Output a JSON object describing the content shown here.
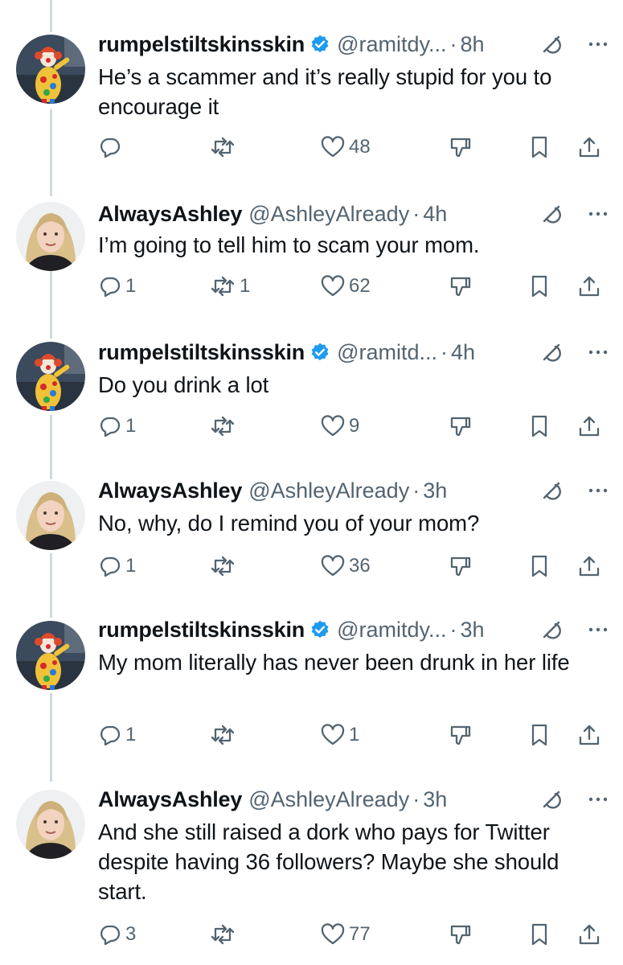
{
  "tweets": [
    {
      "avatar": "clown-avatar",
      "name": "rumpelstiltskinsskin",
      "verified": true,
      "handle": "@ramitdy...",
      "time": "8h",
      "text": "He’s a scammer and it’s really stupid for you to encourage it",
      "replies": "",
      "retweets": "",
      "likes": "48"
    },
    {
      "avatar": "woman-avatar",
      "name": "AlwaysAshley",
      "verified": false,
      "handle": "@AshleyAlready",
      "time": "4h",
      "text": "I’m going to tell him to scam your mom.",
      "replies": "1",
      "retweets": "1",
      "likes": "62"
    },
    {
      "avatar": "clown-avatar",
      "name": "rumpelstiltskinsskin",
      "verified": true,
      "handle": "@ramitd...",
      "time": "4h",
      "text": "Do you drink a lot",
      "replies": "1",
      "retweets": "",
      "likes": "9"
    },
    {
      "avatar": "woman-avatar",
      "name": "AlwaysAshley",
      "verified": false,
      "handle": "@AshleyAlready",
      "time": "3h",
      "text": "No, why, do I remind you of your mom?",
      "replies": "1",
      "retweets": "",
      "likes": "36"
    },
    {
      "avatar": "clown-avatar",
      "name": "rumpelstiltskinsskin",
      "verified": true,
      "handle": "@ramitdy...",
      "time": "3h",
      "text": "My mom literally has never been drunk in her life",
      "replies": "1",
      "retweets": "",
      "likes": "1"
    },
    {
      "avatar": "woman-avatar",
      "name": "AlwaysAshley",
      "verified": false,
      "handle": "@AshleyAlready",
      "time": "3h",
      "text": "And she still raised a dork who pays for Twitter despite having 36 followers? Maybe she should start.",
      "replies": "3",
      "retweets": "",
      "likes": "77"
    }
  ],
  "separator": "·",
  "icons": {
    "verified": "verified-badge-icon",
    "grok": "grok-icon",
    "more": "more-icon",
    "reply": "reply-icon",
    "retweet": "retweet-icon",
    "like": "like-icon",
    "dislike": "dislike-icon",
    "bookmark": "bookmark-icon",
    "share": "share-icon"
  },
  "colors": {
    "text": "#0f1419",
    "secondary": "#536471",
    "verified": "#1d9bf0",
    "thread_line": "#cfd9de"
  }
}
